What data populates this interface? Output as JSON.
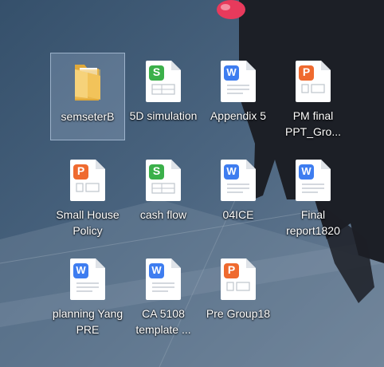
{
  "desktop": {
    "icons": [
      {
        "label": "semseterB",
        "type": "folder",
        "icon": "folder-icon",
        "selected": true
      },
      {
        "label": "5D simulation",
        "type": "sheet",
        "icon": "spreadsheet-icon"
      },
      {
        "label": "Appendix 5",
        "type": "doc",
        "icon": "word-document-icon"
      },
      {
        "label": "PM final PPT_Gro...",
        "type": "ppt",
        "icon": "presentation-icon"
      },
      {
        "label": "Small House Policy",
        "type": "ppt",
        "icon": "presentation-icon"
      },
      {
        "label": "cash flow",
        "type": "sheet",
        "icon": "spreadsheet-icon"
      },
      {
        "label": "04ICE",
        "type": "doc",
        "icon": "word-document-icon"
      },
      {
        "label": "Final report1820",
        "type": "doc",
        "icon": "word-document-icon"
      },
      {
        "label": "planning Yang PRE",
        "type": "doc",
        "icon": "word-document-icon"
      },
      {
        "label": "CA 5108 template ...",
        "type": "doc",
        "icon": "word-document-icon"
      },
      {
        "label": "Pre Group18",
        "type": "ppt",
        "icon": "presentation-icon"
      }
    ],
    "colors": {
      "sheet_badge": "#3bb04a",
      "doc_badge": "#3e7df0",
      "ppt_badge": "#ef6a2f",
      "folder": "#f2c35a"
    }
  }
}
